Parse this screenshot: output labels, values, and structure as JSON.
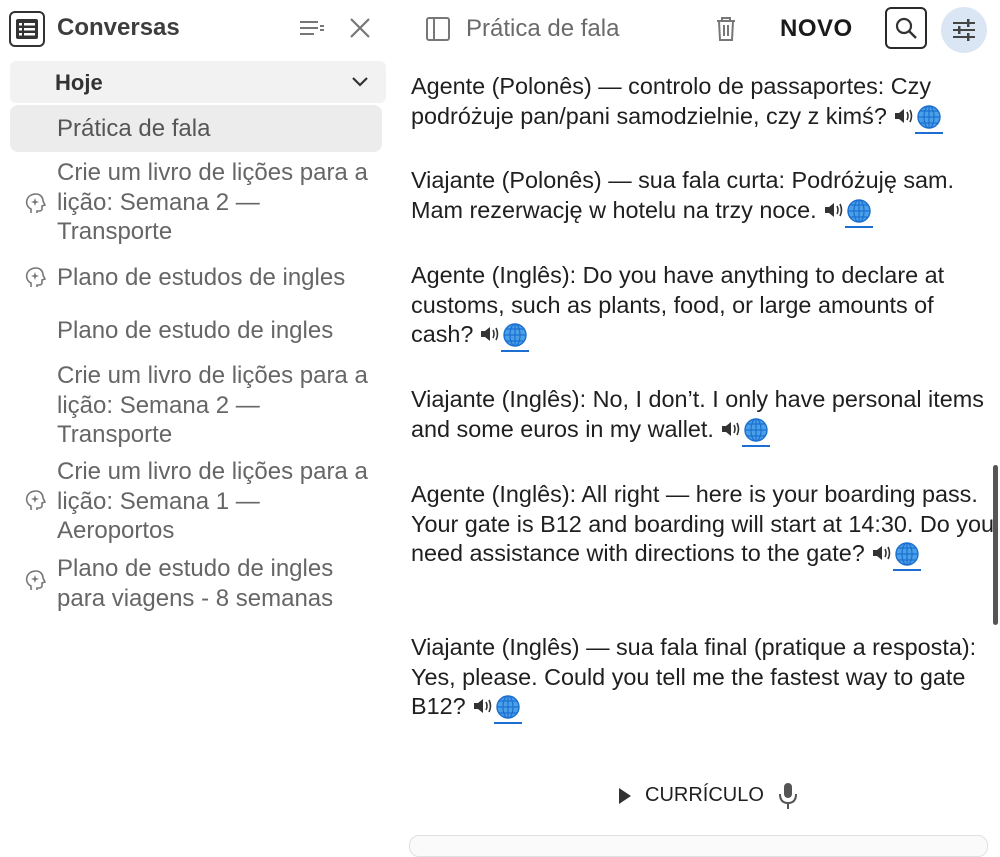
{
  "sidebar": {
    "title": "Conversas",
    "group": {
      "label": "Hoje"
    },
    "items": [
      {
        "label": "Prática de fala",
        "icon": ""
      },
      {
        "label": "Crie um livro de lições para a lição: Semana 2 — Transporte",
        "icon": "brain-sparkle-icon"
      },
      {
        "label": "Plano de estudos de ingles",
        "icon": "brain-sparkle-icon"
      },
      {
        "label": "Plano de estudo de ingles",
        "icon": ""
      },
      {
        "label": "Crie um livro de lições para a lição: Semana 2 — Transporte",
        "icon": ""
      },
      {
        "label": "Crie um livro de lições para a lição: Semana 1 — Aeroportos",
        "icon": "brain-sparkle-icon"
      },
      {
        "label": "Plano de estudo de ingles para viagens - 8 semanas",
        "icon": "brain-sparkle-icon"
      }
    ]
  },
  "toolbar": {
    "title": "Prática de fala",
    "new_label": "NOVO"
  },
  "messages": [
    {
      "text": "Agente (Polonês) — controlo de passaportes: Czy podróżuje pan/pani samodzielnie, czy z kimś?"
    },
    {
      "text": "Viajante (Polonês) — sua fala curta: Podróżuję sam. Mam rezerwację w hotelu na trzy noce."
    },
    {
      "text": "Agente (Inglês): Do you have anything to declare at customs, such as plants, food, or large amounts of cash?"
    },
    {
      "text": "Viajante (Inglês): No, I don’t. I only have personal items and some euros in my wallet."
    },
    {
      "text": "Agente (Inglês): All right — here is your boarding pass. Your gate is B12 and boarding will start at 14:30. Do you need assistance with directions to the gate?"
    },
    {
      "text": "Viajante (Inglês) — sua fala final (pratique a resposta): Yes, please. Could you tell me the fastest way to gate B12?"
    }
  ],
  "bottom": {
    "curriculum_label": "CURRÍCULO"
  },
  "colors": {
    "accent_bg": "#dbe6f4",
    "link_blue": "#1c6fd1"
  }
}
